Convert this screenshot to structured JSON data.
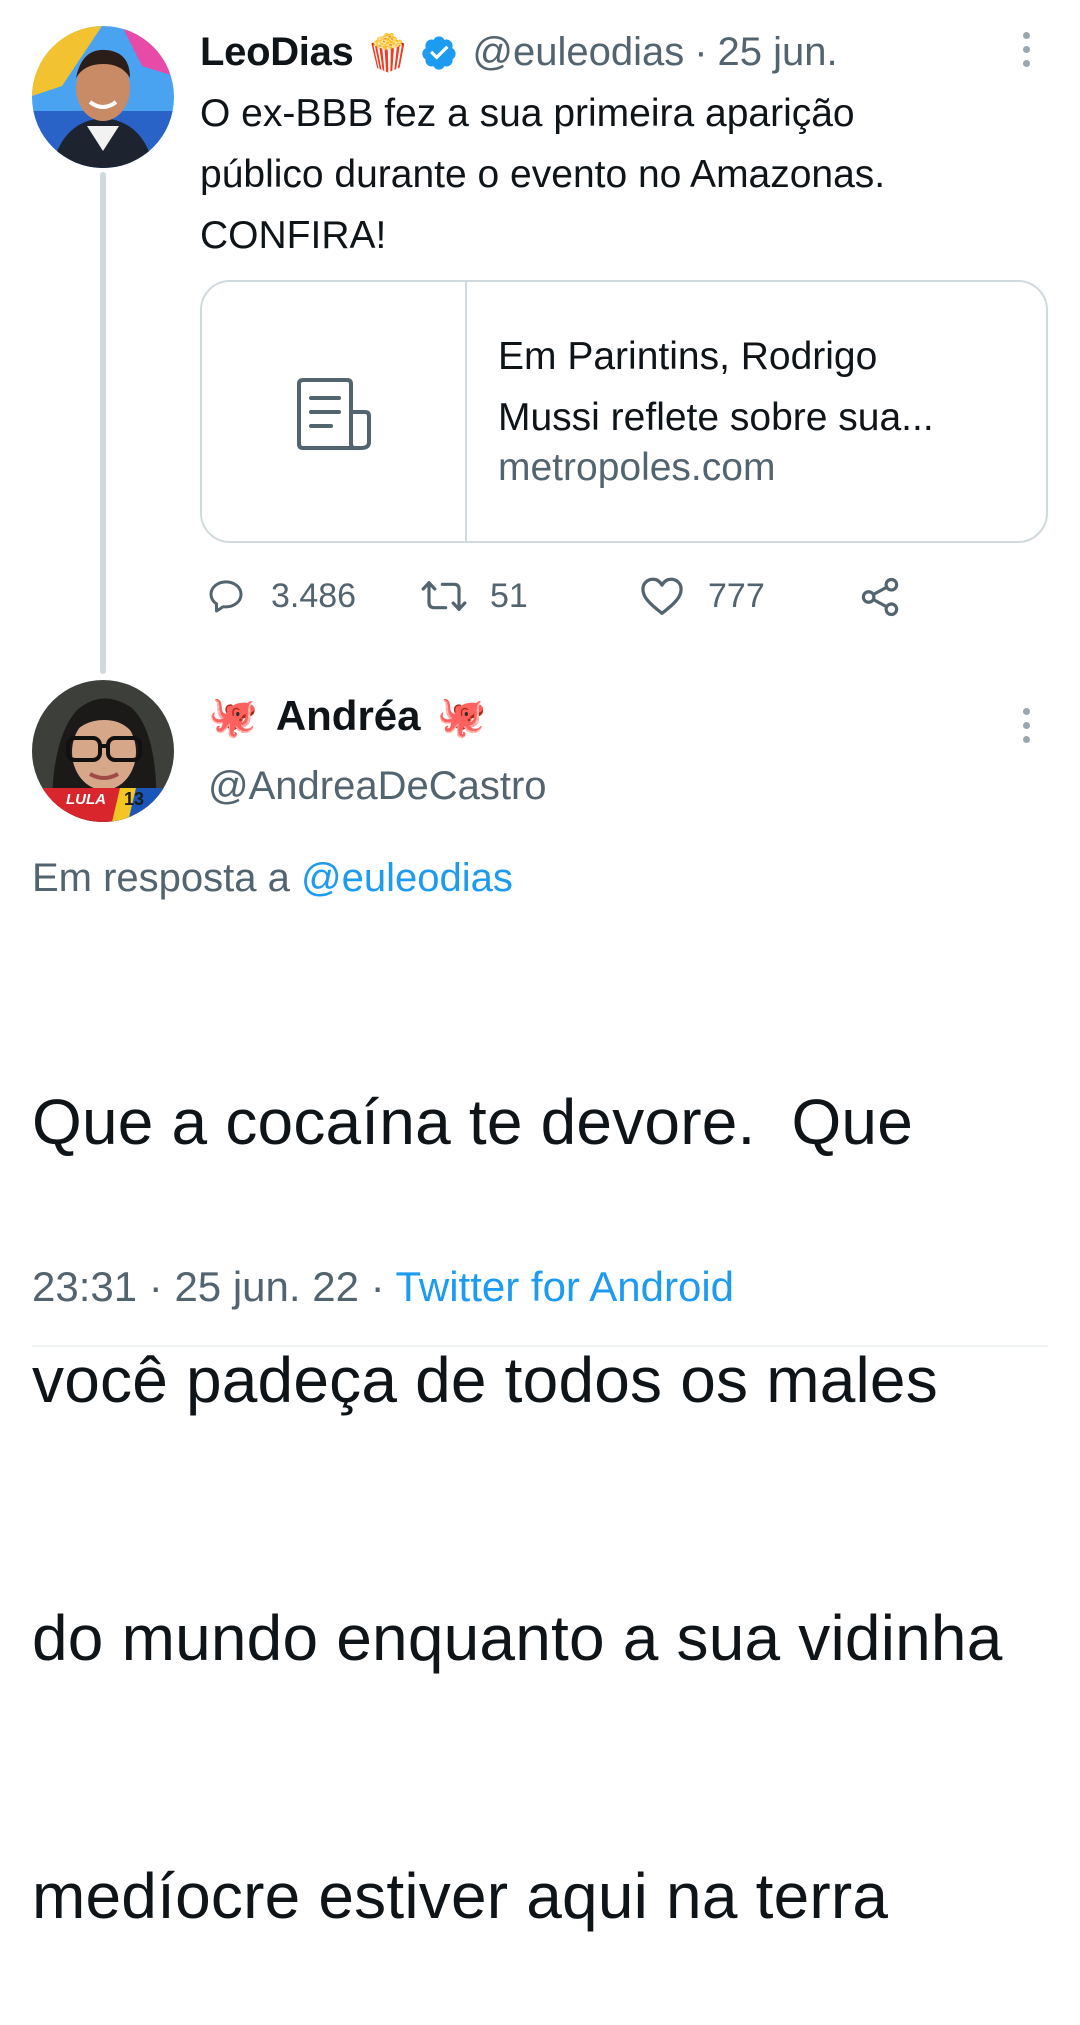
{
  "tweet1": {
    "display_name": "LeoDias",
    "name_emoji": "🍿",
    "verified_icon": "verified-badge-icon",
    "handle": "@euleodias",
    "separator": "·",
    "date": "25 jun.",
    "text_lines": [
      "O ex-BBB fez a sua primeira aparição",
      "público durante o evento no Amazonas.",
      "CONFIRA!"
    ],
    "card": {
      "icon": "article-icon",
      "title_lines": [
        "Em Parintins, Rodrigo",
        "Mussi reflete sobre sua..."
      ],
      "domain": "metropoles.com"
    },
    "actions": {
      "replies": "3.486",
      "retweets": "51",
      "likes": "777"
    }
  },
  "tweet2": {
    "name_emoji_left": "🐙",
    "display_name": "Andréa",
    "name_emoji_right": "🐙",
    "handle": "@AndreaDeCastro",
    "avatar_badge": "LULA",
    "avatar_badge_num": "13",
    "reply_prefix": "Em resposta a",
    "reply_handle": "@euleodias",
    "text_lines": [
      "Que a cocaína te devore.  Que",
      "você padeça de todos os males",
      "do mundo enquanto a sua vidinha",
      "medíocre estiver aqui na terra"
    ],
    "time": "23:31",
    "separator": "·",
    "date": "25 jun. 22",
    "source": "Twitter for Android"
  },
  "colors": {
    "accent": "#1d9bf0",
    "secondary_text": "#536471",
    "border": "#cfd9de"
  }
}
